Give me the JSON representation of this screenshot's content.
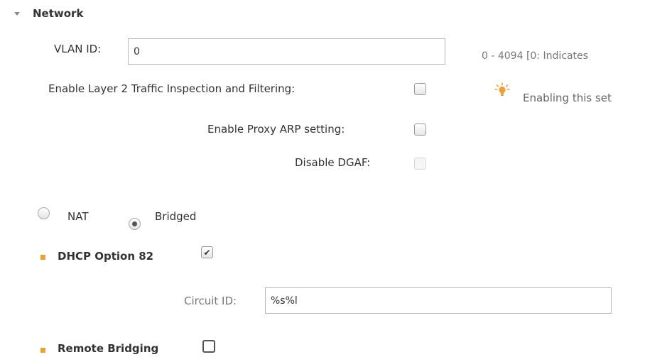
{
  "network": {
    "title": "Network",
    "vlan": {
      "label": "VLAN ID:",
      "value": "0",
      "hint": "0 - 4094 [0: Indicates"
    },
    "layer2": {
      "label": "Enable Layer 2 Traffic Inspection and Filtering:",
      "checked": false,
      "tip": "Enabling this set"
    },
    "proxy_arp": {
      "label": "Enable Proxy ARP setting:",
      "checked": false
    },
    "dgaf": {
      "label": "Disable DGAF:",
      "checked": false,
      "disabled": true
    },
    "mode": {
      "options": [
        "NAT",
        "Bridged"
      ],
      "selected": "Bridged"
    },
    "dhcp82": {
      "label": "DHCP Option 82",
      "checked": true,
      "circuit_label": "Circuit ID:",
      "circuit_value": "%s%l"
    },
    "remote_bridging": {
      "label": "Remote Bridging",
      "checked": false
    }
  },
  "colors": {
    "bullet": "#f0a030",
    "bulb": "#f0a030",
    "text": "#333333",
    "muted": "#777777"
  },
  "icons": {
    "caret": "caret-down-icon",
    "tip": "lightbulb-icon",
    "check": "checkmark-icon"
  }
}
